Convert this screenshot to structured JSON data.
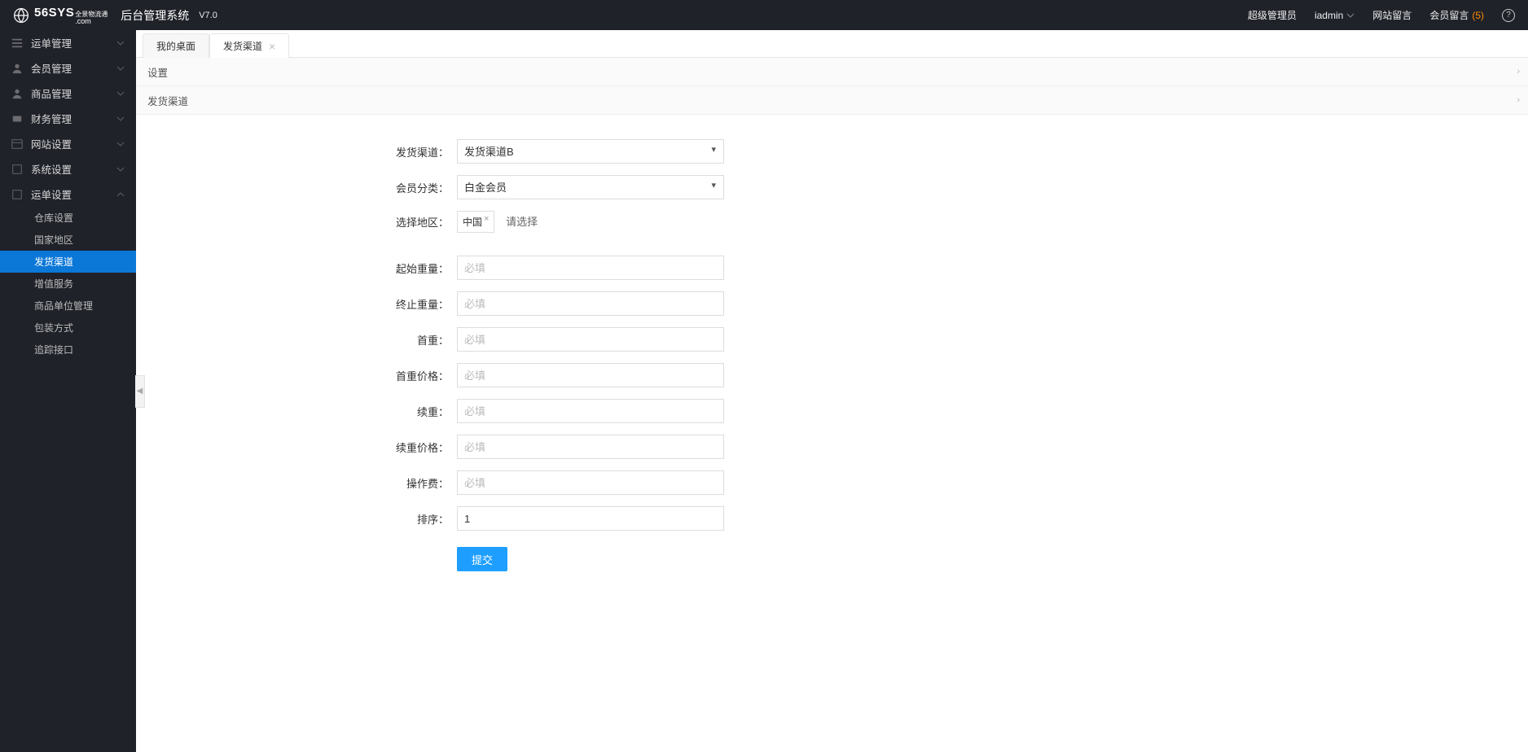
{
  "header": {
    "brand_main": "56SYS",
    "brand_suffix": ".com",
    "brand_tag": "全景物流通",
    "system_title": "后台管理系统",
    "version": "V7.0"
  },
  "top_right": {
    "role": "超级管理员",
    "user": "iadmin",
    "site_msg": "网站留言",
    "member_msg_label": "会员留言",
    "member_msg_count": "(5)"
  },
  "sidebar": {
    "items": [
      {
        "label": "运单管理"
      },
      {
        "label": "会员管理"
      },
      {
        "label": "商品管理"
      },
      {
        "label": "财务管理"
      },
      {
        "label": "网站设置"
      },
      {
        "label": "系统设置"
      },
      {
        "label": "运单设置"
      }
    ],
    "sub_items": [
      {
        "label": "仓库设置"
      },
      {
        "label": "国家地区"
      },
      {
        "label": "发货渠道"
      },
      {
        "label": "增值服务"
      },
      {
        "label": "商品单位管理"
      },
      {
        "label": "包装方式"
      },
      {
        "label": "追踪接口"
      }
    ]
  },
  "tabs": {
    "tab1": "我的桌面",
    "tab2": "发货渠道"
  },
  "sections": {
    "settings": "设置",
    "channel": "发货渠道"
  },
  "form": {
    "channel_label": "发货渠道：",
    "channel_value": "发货渠道B",
    "member_type_label": "会员分类：",
    "member_type_value": "白金会员",
    "region_label": "选择地区：",
    "region_tag": "中国",
    "region_hint": "请选择",
    "start_weight_label": "起始重量：",
    "end_weight_label": "终止重量：",
    "first_weight_label": "首重：",
    "first_weight_price_label": "首重价格：",
    "cont_weight_label": "续重：",
    "cont_weight_price_label": "续重价格：",
    "op_fee_label": "操作费：",
    "sort_label": "排序：",
    "sort_value": "1",
    "placeholder_required": "必填",
    "submit": "提交"
  }
}
